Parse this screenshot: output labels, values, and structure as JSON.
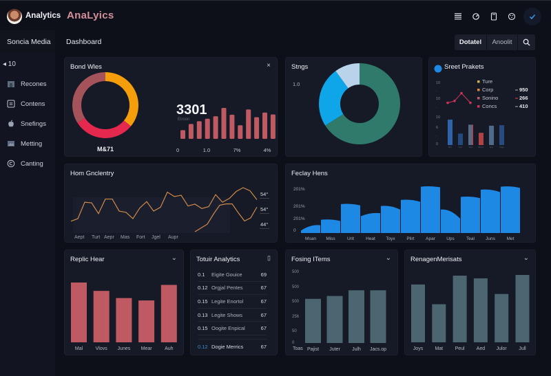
{
  "header": {
    "brand": "Analytics",
    "title": "AnaLyics",
    "icons": [
      "menu-icon",
      "refresh-icon",
      "document-icon",
      "palette-icon",
      "check-icon"
    ]
  },
  "sidebar": {
    "heading": "Soncia Media",
    "back_label": "◂ 10",
    "items": [
      {
        "label": "Recones",
        "icon": "folder-icon"
      },
      {
        "label": "Contens",
        "icon": "grid-icon"
      },
      {
        "label": "Snefings",
        "icon": "apple-icon"
      },
      {
        "label": "Metting",
        "icon": "image-icon"
      },
      {
        "label": "Canting",
        "icon": "copyright-icon"
      }
    ]
  },
  "toolbar": {
    "dashboard_label": "Dashboard",
    "segments": [
      "Dotatel",
      "Anoolit"
    ],
    "search_icon": "search-icon"
  },
  "colors": {
    "accent_blue": "#1e88e5",
    "rose": "#c05a62",
    "orange": "#f59e0b",
    "crimson": "#e5284d",
    "teal": "#2f7a6b",
    "slate": "#4b6670"
  },
  "cards": {
    "bond": {
      "title": "Bond Wles",
      "close": "×"
    },
    "stngs": {
      "title": "Stngs"
    },
    "secret": {
      "title": "Sreet Prakets"
    },
    "hom": {
      "title": "Hom Gnclentry"
    },
    "feday": {
      "title": "Feclay Hens"
    },
    "replic": {
      "title": "Replic Hear",
      "ctl": "⌄"
    },
    "totuir": {
      "title": "Totuir Analytics",
      "ctl": "▯"
    },
    "fosing": {
      "title": "Fosing ITems",
      "ctl": "⌄"
    },
    "renagen": {
      "title": "RenagenMerisats",
      "ctl": "⌄"
    }
  },
  "table": {
    "rows": [
      [
        "0.1",
        "Eigite Gouice",
        "69"
      ],
      [
        "0.12",
        "Orgjal Pentes",
        "67"
      ],
      [
        "0.15",
        "Legite Enortol",
        "67"
      ],
      [
        "0.13",
        "Legite Shows",
        "67"
      ],
      [
        "0.15",
        "Oogite Enpical",
        "67"
      ]
    ],
    "total": [
      "0.12",
      "Dogie Merrics",
      "67"
    ]
  },
  "chart_data": [
    {
      "id": "bond-donut",
      "type": "pie",
      "title": "Bond Wles",
      "label": "M&71",
      "slices": [
        {
          "name": "orange",
          "value": 36,
          "color": "#f59e0b"
        },
        {
          "name": "crimson",
          "value": 30,
          "color": "#e5284d"
        },
        {
          "name": "rose",
          "value": 34,
          "color": "#a5535b"
        }
      ]
    },
    {
      "id": "bond-bars",
      "type": "bar",
      "big_number": "3301",
      "caption": "Eiroon",
      "x_ticks": [
        "0",
        "1.0",
        "7%",
        "4%"
      ],
      "values": [
        28,
        48,
        57,
        65,
        73,
        100,
        78,
        44,
        95,
        70,
        85,
        79,
        72
      ],
      "color": "#c05a62"
    },
    {
      "id": "stngs-donut",
      "type": "pie",
      "title": "Stngs",
      "side_label": "1.0",
      "slices": [
        {
          "name": "teal",
          "value": 66,
          "color": "#2f7a6b"
        },
        {
          "name": "blue",
          "value": 24,
          "color": "#0ea5e9"
        },
        {
          "name": "light",
          "value": 10,
          "color": "#b9d4ea"
        }
      ]
    },
    {
      "id": "secret-combo",
      "type": "bar",
      "title": "Sreet Prakets",
      "y_ticks": [
        "10",
        "·",
        "10",
        "·",
        "10",
        "6",
        "·",
        "0"
      ],
      "legend": [
        {
          "name": "Ture",
          "color": "#d4b24a",
          "value": ""
        },
        {
          "name": "Corp",
          "color": "#e08a3a",
          "value": "950"
        },
        {
          "name": "Sonino",
          "color": "#c05a62",
          "value": "266"
        },
        {
          "name": "Concs",
          "color": "#d0335a",
          "value": "410"
        }
      ],
      "legend_dash_colors": [
        "#9fb6c9",
        "#e5484d",
        "#9fb6c9"
      ],
      "line": [
        3,
        4,
        8,
        3
      ],
      "bars": [
        {
          "value": 10,
          "color": "#2e63a8"
        },
        {
          "value": 4.5,
          "color": "#23497f"
        },
        {
          "value": 8,
          "color": "#566a86",
          "accent": "#b34245"
        },
        {
          "value": 4.8,
          "color": "#b34245"
        },
        {
          "value": 7.6,
          "color": "#4f6b8c"
        },
        {
          "value": 7.8,
          "color": "#284c80"
        }
      ],
      "x_ticks": [
        "Bot",
        "Corr",
        "Sele",
        "Bronc",
        "Eve",
        "Soge"
      ]
    },
    {
      "id": "hom-line",
      "type": "line",
      "title": "Hom Gnclentry",
      "x_ticks": [
        "Aept",
        "Turt",
        "Aepr",
        "Mas",
        "Fort",
        "Jgel",
        "Aupr"
      ],
      "right_labels": [
        "54°",
        "54°",
        "44°"
      ],
      "series": [
        {
          "name": "main",
          "color": "#d08a4a",
          "values": [
            10,
            14,
            40,
            39,
            22,
            45,
            45,
            26,
            24,
            14,
            31,
            41,
            26,
            32,
            56,
            49,
            51,
            34,
            37,
            30,
            33,
            52,
            40,
            46,
            57,
            63,
            58,
            44
          ]
        },
        {
          "name": "secondary",
          "color": "#d08a4a",
          "values": [
            2,
            8,
            14,
            30,
            44,
            46,
            46,
            32,
            19,
            24,
            41
          ]
        }
      ]
    },
    {
      "id": "feday-bars",
      "type": "bar",
      "title": "Feclay Hens",
      "y_ticks": [
        "0",
        "201%",
        "201%",
        "201%"
      ],
      "categories": [
        "Msan",
        "Miss",
        "Urit",
        "Heat",
        "Toyx",
        "Plirt",
        "Apar",
        "Ups",
        "Teal",
        "Juns",
        "Met"
      ],
      "values": [
        [
          4,
          13
        ],
        [
          22,
          20
        ],
        [
          48,
          46
        ],
        [
          28,
          33
        ],
        [
          45,
          39
        ],
        [
          55,
          52
        ],
        [
          77,
          76
        ],
        [
          39,
          24
        ],
        [
          60,
          58
        ],
        [
          72,
          68
        ],
        [
          77,
          75
        ]
      ],
      "color": "#1e88e5"
    },
    {
      "id": "replic-bars",
      "type": "bar",
      "title": "Replic Hear",
      "categories": [
        "Mal",
        "Vlovs",
        "Junes",
        "Mear",
        "Auh"
      ],
      "values": [
        100,
        86,
        74,
        70,
        96
      ],
      "color": "#c05a62"
    },
    {
      "id": "fosing-bars",
      "type": "bar",
      "title": "Fosing ITems",
      "y_ticks": [
        "0",
        "50",
        "256",
        "500",
        "500",
        "500"
      ],
      "categories": [
        "Pajist",
        "Juter",
        "Julh",
        "Jacs.op"
      ],
      "first_tick": "Toas",
      "values": [
        62,
        66,
        74,
        74
      ],
      "ylim": [
        0,
        110
      ],
      "color": "#4b6670"
    },
    {
      "id": "renagen-bars",
      "type": "bar",
      "title": "RenagenMerisats",
      "categories": [
        "Joys",
        "Mat",
        "Peul",
        "Aed",
        "Julor",
        "Jull"
      ],
      "values": [
        85,
        56,
        98,
        94,
        71,
        99
      ],
      "color": "#4b6670"
    }
  ]
}
